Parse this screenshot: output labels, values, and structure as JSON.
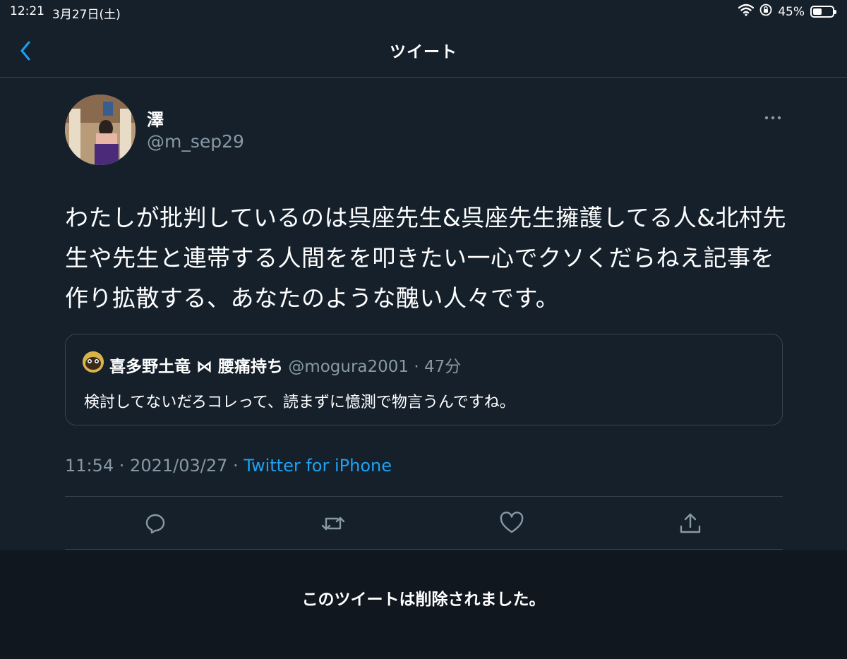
{
  "status_bar": {
    "time": "12:21",
    "date": "3月27日(土)",
    "battery": "45%",
    "battery_level": 0.45
  },
  "header": {
    "title": "ツイート"
  },
  "tweet": {
    "display_name": "澤",
    "handle": "@m_sep29",
    "text": "わたしが批判しているのは呉座先生&呉座先生擁護してる人&北村先生や先生と連帯する人間をを叩きたい一心でクソくだらねえ記事を作り拡散する、あなたのような醜い人々です。",
    "timestamp": "11:54 · 2021/03/27 · ",
    "source": "Twitter for iPhone"
  },
  "quoted_tweet": {
    "display_name": "喜多野土竜 ⋈ 腰痛持ち",
    "handle_time": " @mogura2001 · 47分",
    "text": "検討してないだろコレって、読まずに憶測で物言うんですね。"
  },
  "actions": [
    "reply",
    "retweet",
    "like",
    "share"
  ],
  "banner": {
    "text": "このツイートは削除されました。"
  },
  "colors": {
    "background": "#15202b",
    "border": "#38444d",
    "secondary_text": "#8899a6",
    "accent": "#1da1f2"
  }
}
